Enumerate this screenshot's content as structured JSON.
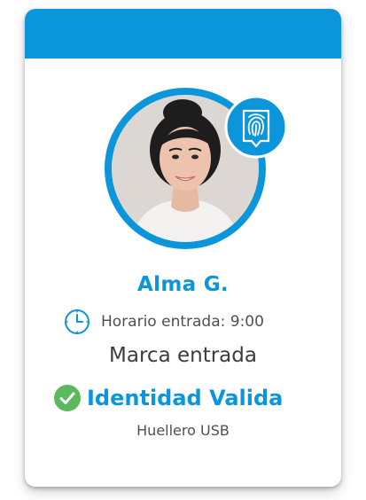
{
  "card": {
    "name": "Alma  G.",
    "schedule_text": "Horario entrada: 9:00",
    "mark_text": "Marca entrada",
    "identity_text": "Identidad Valida",
    "device_text": "Huellero USB"
  },
  "icons": {
    "badge": "fingerprint-icon",
    "schedule": "clock-icon",
    "identity": "check-circle-icon"
  },
  "colors": {
    "accent": "#0b95da",
    "success": "#5cb85c",
    "text": "#505050"
  }
}
